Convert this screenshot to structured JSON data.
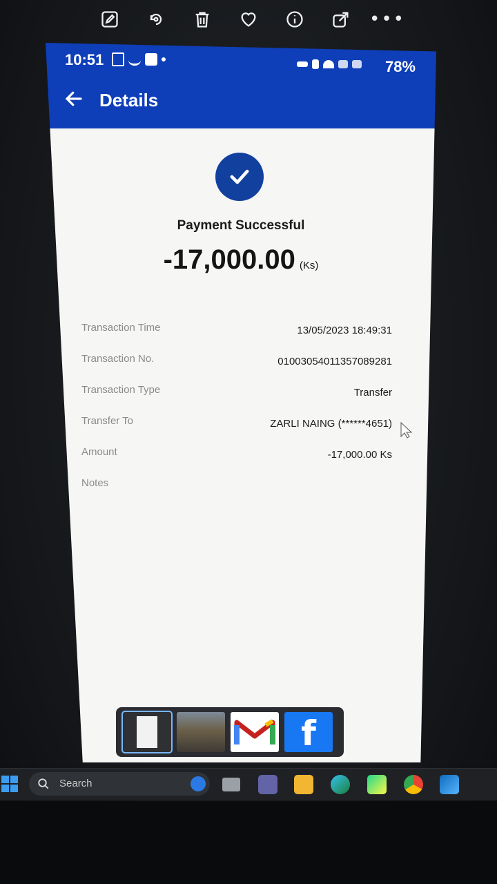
{
  "toolbar": {
    "icons": [
      "edit-icon",
      "rotate-icon",
      "delete-icon",
      "favorite-icon",
      "info-icon",
      "share-icon",
      "more-icon"
    ],
    "more_label": "•••"
  },
  "phone": {
    "status_bar": {
      "time": "10:51",
      "battery": "78%"
    },
    "app_bar": {
      "title": "Details"
    },
    "payment": {
      "status": "Payment Successful",
      "amount": "-17,000.00",
      "unit": "(Ks)"
    },
    "details": [
      {
        "label": "Transaction Time",
        "value": "13/05/2023 18:49:31"
      },
      {
        "label": "Transaction No.",
        "value": "01003054011357089281"
      },
      {
        "label": "Transaction Type",
        "value": "Transfer"
      },
      {
        "label": "Transfer To",
        "value": "ZARLI NAING (******4651)"
      },
      {
        "label": "Amount",
        "value": "-17,000.00 Ks"
      },
      {
        "label": "Notes",
        "value": ""
      }
    ],
    "colors": {
      "brand": "#0e3fb9",
      "check": "#12409f"
    }
  },
  "thumbnails": [
    "document-thumbnail",
    "building-photo-thumbnail",
    "gmail-thumbnail",
    "facebook-thumbnail"
  ],
  "taskbar": {
    "search_label": "Search",
    "apps": [
      "bing-icon",
      "task-view-icon",
      "teams-icon",
      "file-explorer-icon",
      "edge-icon",
      "pycharm-icon",
      "chrome-icon",
      "photos-icon"
    ]
  }
}
